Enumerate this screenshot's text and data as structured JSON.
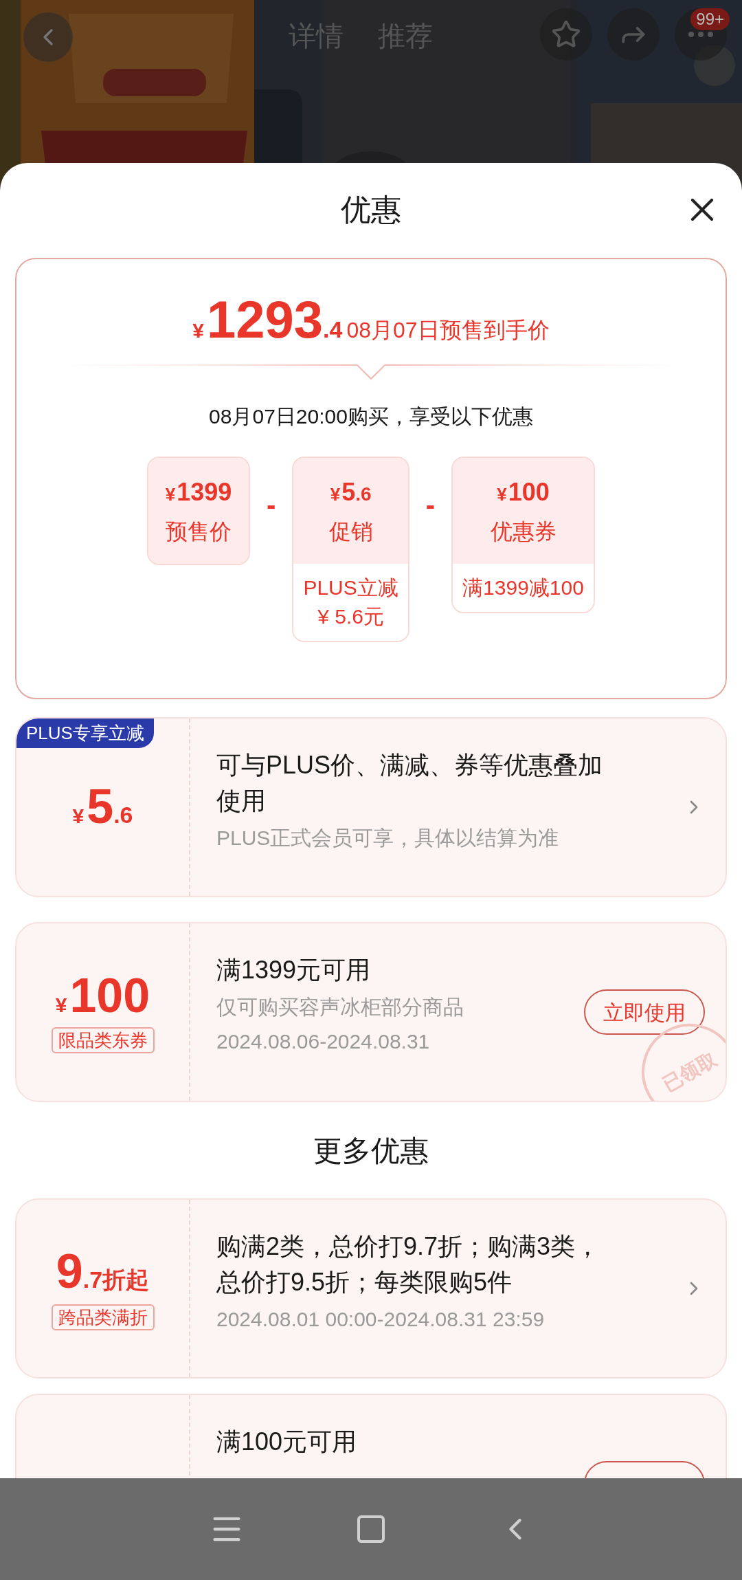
{
  "product_page": {
    "tabs": [
      {
        "label": "详情"
      },
      {
        "label": "推荐"
      }
    ],
    "badge": "99+"
  },
  "sheet": {
    "title": "优惠"
  },
  "price_summary": {
    "currency": "¥",
    "integer": "1293",
    "decimal": ".4",
    "label": "08月07日预售到手价",
    "note": "08月07日20:00购买，享受以下优惠",
    "terms": [
      {
        "currency": "¥",
        "integer": "1399",
        "label": "预售价"
      },
      {
        "operator": "-",
        "currency": "¥",
        "integer": "5",
        "decimal": ".6",
        "label": "促销",
        "detail": [
          "PLUS立减",
          "¥ 5.6元"
        ]
      },
      {
        "operator": "-",
        "currency": "¥",
        "integer": "100",
        "label": "优惠券",
        "detail": [
          "满1399减100"
        ]
      }
    ]
  },
  "coupons": [
    {
      "tag": "PLUS专享立减",
      "currency": "¥",
      "integer": "5",
      "decimal": ".6",
      "title": "可与PLUS价、满减、券等优惠叠加使用",
      "lines": [
        "PLUS正式会员可享，具体以结算为准"
      ],
      "kind": "chevron"
    },
    {
      "currency": "¥",
      "integer": "100",
      "label": "限品类东券",
      "title": "满1399元可用",
      "lines": [
        "仅可购买容声冰柜部分商品",
        "2024.08.06-2024.08.31"
      ],
      "kind": "button",
      "button": "立即使用",
      "stamp": "已领取"
    }
  ],
  "more": {
    "title": "更多优惠",
    "offers": [
      {
        "integer": "9",
        "decimal": ".7折起",
        "label": "跨品类满折",
        "title": "购满2类，总价打9.7折；购满3类，总价打9.5折；每类限购5件",
        "lines": [
          "2024.08.01 00:00-2024.08.31 23:59"
        ],
        "kind": "chevron"
      },
      {
        "title": "满100元可用",
        "kind": "button"
      }
    ]
  }
}
